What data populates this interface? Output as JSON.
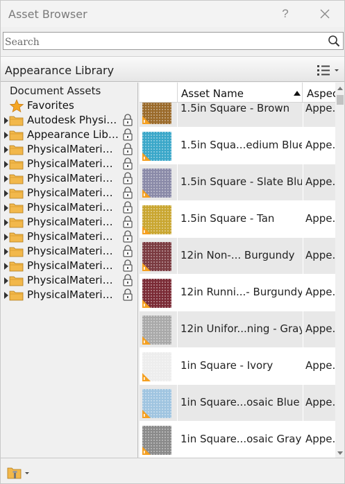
{
  "window": {
    "title": "Asset Browser",
    "help_label": "?"
  },
  "search": {
    "placeholder": "Search",
    "value": ""
  },
  "library_bar": {
    "title": "Appearance Library"
  },
  "tree": {
    "root": "Document Assets",
    "favorites": "Favorites",
    "items": [
      {
        "label": "Autodesk Physic..."
      },
      {
        "label": "Appearance Libr..."
      },
      {
        "label": "PhysicalMaterial..."
      },
      {
        "label": "PhysicalMaterial..."
      },
      {
        "label": "PhysicalMaterial..."
      },
      {
        "label": "PhysicalMaterial..."
      },
      {
        "label": "PhysicalMaterial..."
      },
      {
        "label": "PhysicalMaterial..."
      },
      {
        "label": "PhysicalMaterial..."
      },
      {
        "label": "PhysicalMaterial..."
      },
      {
        "label": "PhysicalMaterial..."
      },
      {
        "label": "PhysicalMaterial..."
      },
      {
        "label": "PhysicalMaterial..."
      }
    ]
  },
  "grid": {
    "columns": {
      "name": "Asset Name",
      "aspect": "Aspect"
    },
    "rows": [
      {
        "name": "1.5in Square - Brown",
        "aspect": "Appe...",
        "swatch": "#9a6a2a"
      },
      {
        "name": "1.5in Squa...edium Blue",
        "aspect": "Appe...",
        "swatch": "#3aa7c9"
      },
      {
        "name": "1.5in Square - Slate Blue",
        "aspect": "Appe...",
        "swatch": "#8a8aa8"
      },
      {
        "name": "1.5in Square - Tan",
        "aspect": "Appe...",
        "swatch": "#c9a630"
      },
      {
        "name": "12in Non-... Burgundy",
        "aspect": "Appe...",
        "swatch": "#7a3a40"
      },
      {
        "name": "12in Runni...- Burgundy",
        "aspect": "Appe...",
        "swatch": "#7a2a35"
      },
      {
        "name": "12in Unifor...ning - Gray",
        "aspect": "Appe...",
        "swatch": "#a9a9a9"
      },
      {
        "name": "1in Square - Ivory",
        "aspect": "Appe...",
        "swatch": "#ededed"
      },
      {
        "name": "1in Square...osaic Blue",
        "aspect": "Appe...",
        "swatch": "#9fc4e0"
      },
      {
        "name": "1in Square...osaic Gray",
        "aspect": "Appe...",
        "swatch": "#8a8a8a"
      }
    ]
  },
  "colors": {
    "accent_orange": "#f5a020",
    "folder": "#f2b84b"
  }
}
